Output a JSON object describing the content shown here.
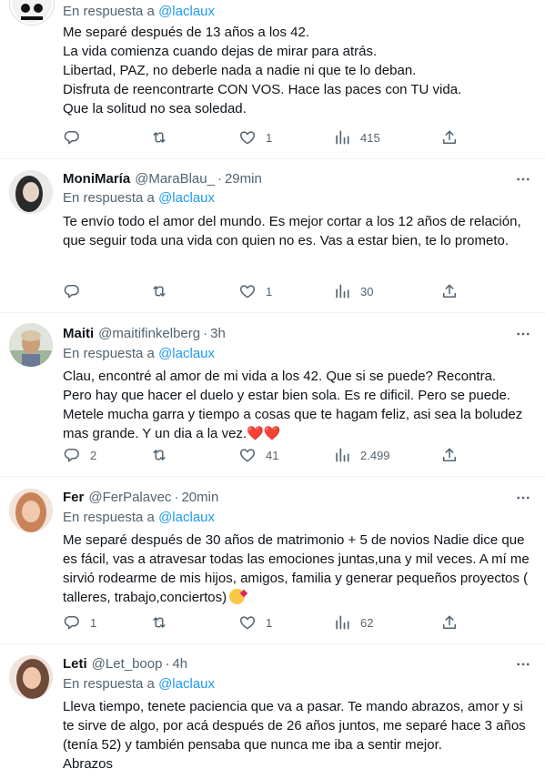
{
  "tweets": [
    {
      "name": "",
      "handle": "",
      "time": "",
      "reply_prefix": "En respuesta a",
      "reply_to": "@laclaux",
      "text": "Me separé después de 13 años a los 42.\nLa vida comienza cuando dejas de mirar para atrás.\nLibertad, PAZ, no deberle nada a nadie ni que te lo deban.\nDisfruta de reencontrarte CON VOS. Hace las paces con TU vida.\nQue la solitud no sea soledad.",
      "replies": "",
      "retweets": "",
      "likes": "1",
      "views": "415"
    },
    {
      "name": "MoniMaría",
      "handle": "@MaraBlau_",
      "time": "29min",
      "reply_prefix": "En respuesta a",
      "reply_to": "@laclaux",
      "text": "Te envío todo el amor del mundo. Es mejor cortar a los 12 años de relación, que seguir toda una vida con quien no es. Vas a estar bien, te lo prometo.",
      "replies": "",
      "retweets": "",
      "likes": "1",
      "views": "30"
    },
    {
      "name": "Maiti",
      "handle": "@maitifinkelberg",
      "time": "3h",
      "reply_prefix": "En respuesta a",
      "reply_to": "@laclaux",
      "text": "Clau, encontré al amor de mi vida a los 42. Que si se puede? Recontra.\nPero hay que hacer el duelo y estar bien sola. Es re dificil. Pero se puede.\nMetele mucha garra y tiempo a cosas que te hagam feliz, asi sea la boludez mas grande. Y un dia a la vez.",
      "emoji": "❤️❤️",
      "replies": "2",
      "retweets": "",
      "likes": "41",
      "views": "2.499"
    },
    {
      "name": "Fer",
      "handle": "@FerPalavec",
      "time": "20min",
      "reply_prefix": "En respuesta a",
      "reply_to": "@laclaux",
      "text": "Me separé después de 30 años de matrimonio + 5 de novios Nadie dice que es fácil, vas a atravesar todas las emociones juntas,una y mil veces. A mí me sirvió rodearme de mis hijos, amigos, familia y generar pequeños proyectos ( talleres, trabajo,conciertos)",
      "replies": "1",
      "retweets": "",
      "likes": "1",
      "views": "62"
    },
    {
      "name": "Leti",
      "handle": "@Let_boop",
      "time": "4h",
      "reply_prefix": "En respuesta a",
      "reply_to": "@laclaux",
      "text": "Lleva tiempo, tenete paciencia que va a pasar. Te mando abrazos, amor y si te sirve de algo, por acá después de 26 años juntos, me separé hace 3 años (tenía 52) y también pensaba que nunca me iba a sentir mejor.\nAbrazos",
      "replies": "",
      "retweets": "",
      "likes": "",
      "views": ""
    }
  ],
  "colors": {
    "text": "#0f1419",
    "secondary": "#536471",
    "link": "#1d9bf0",
    "divider": "#eff3f4"
  },
  "icons": [
    "reply-icon",
    "retweet-icon",
    "like-icon",
    "views-icon",
    "share-icon",
    "more-icon"
  ]
}
